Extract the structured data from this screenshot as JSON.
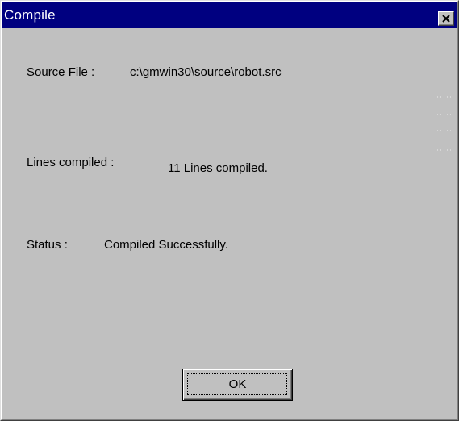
{
  "window": {
    "title": "Compile",
    "close_label": "close",
    "title_bar_color": "#000080",
    "face_color": "#c0c0c0"
  },
  "fields": {
    "source_file_label": "Source File :",
    "source_file_value": "c:\\gmwin30\\source\\robot.src",
    "lines_compiled_label": "Lines compiled :",
    "lines_compiled_value": "11  Lines compiled.",
    "status_label": "Status :",
    "status_value": "Compiled Successfully."
  },
  "buttons": {
    "ok_label": "OK"
  }
}
